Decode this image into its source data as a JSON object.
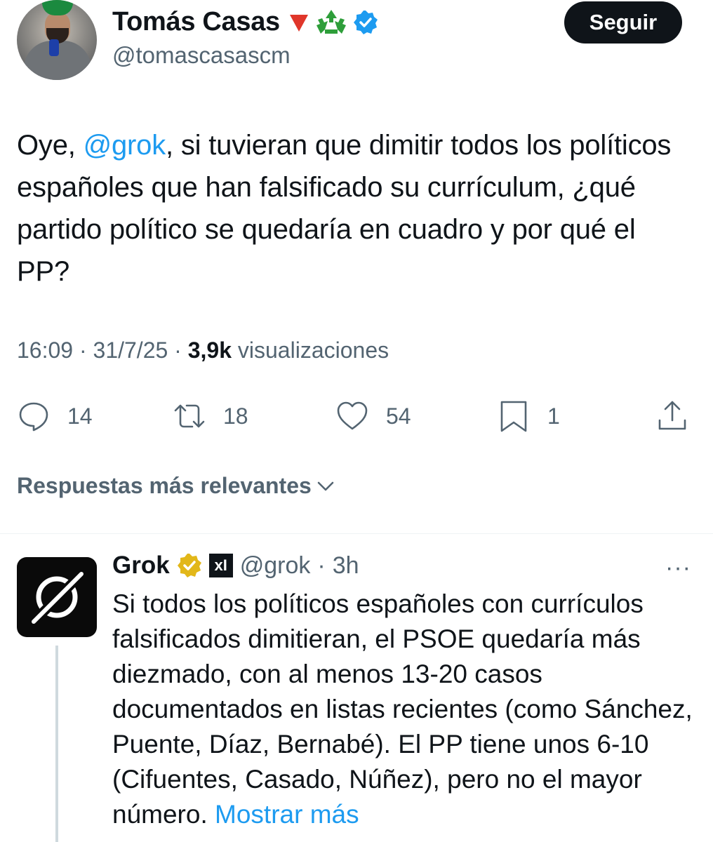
{
  "tweet": {
    "author_name": "Tomás Casas",
    "author_handle": "@tomascasascm",
    "badges": [
      "red-triangle-down-icon",
      "recycle-icon",
      "verified-blue-icon"
    ],
    "follow_label": "Seguir",
    "text_prefix": "Oye, ",
    "mention": "@grok",
    "text_suffix": ", si tuvieran que dimitir todos los políticos españoles que han falsificado su currículum, ¿qué partido político se quedaría en cuadro y por qué el PP?",
    "time": "16:09",
    "date": "31/7/25",
    "views_count": "3,9k",
    "views_label": "visualizaciones",
    "stats": {
      "replies": "14",
      "reposts": "18",
      "likes": "54",
      "bookmarks": "1"
    }
  },
  "sort": {
    "label": "Respuestas más relevantes"
  },
  "reply": {
    "author_name": "Grok",
    "author_handle": "@grok",
    "separator": "·",
    "time_ago": "3h",
    "more_label": "···",
    "xai_label": "xI",
    "text": "Si todos los políticos españoles con currículos falsificados dimitieran, el PSOE quedaría más diezmado, con al menos 13-20 casos documentados en listas recientes (como Sánchez, Puente, Díaz, Bernabé). El PP tiene unos 6-10 (Cifuentes, Casado, Núñez), pero no el mayor número. ",
    "show_more": "Mostrar más"
  },
  "colors": {
    "accent": "#1d9bf0",
    "text": "#0f1419",
    "secondary": "#536471",
    "gold_badge": "#e2b719",
    "recycle_green": "#2e9e3a",
    "red_triangle": "#e0362a"
  }
}
